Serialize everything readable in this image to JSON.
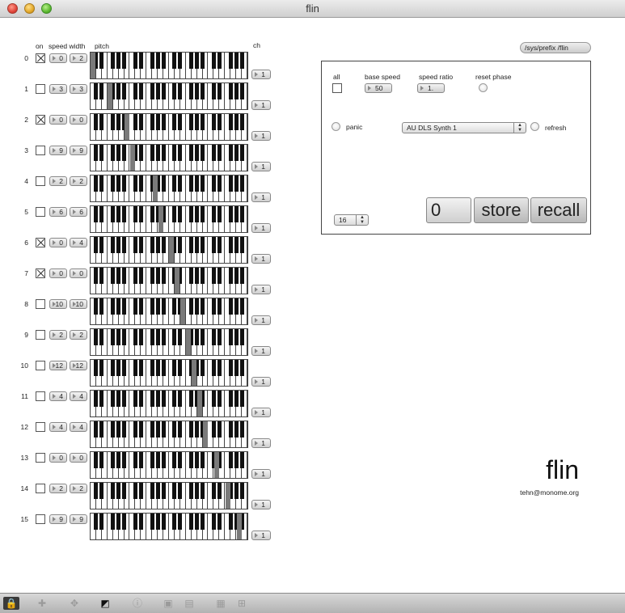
{
  "window": {
    "title": "flin"
  },
  "headers": {
    "on": "on",
    "speed_width": "speed width",
    "pitch": "pitch",
    "ch": "ch"
  },
  "rows": [
    {
      "label": "0",
      "on": true,
      "speed": "0",
      "width": "2",
      "ch": "1",
      "pitch": 0
    },
    {
      "label": "1",
      "on": false,
      "speed": "3",
      "width": "3",
      "ch": "1",
      "pitch": 3
    },
    {
      "label": "2",
      "on": true,
      "speed": "0",
      "width": "0",
      "ch": "1",
      "pitch": 6
    },
    {
      "label": "3",
      "on": false,
      "speed": "9",
      "width": "9",
      "ch": "1",
      "pitch": 7
    },
    {
      "label": "4",
      "on": false,
      "speed": "2",
      "width": "2",
      "ch": "1",
      "pitch": 11
    },
    {
      "label": "5",
      "on": false,
      "speed": "6",
      "width": "6",
      "ch": "1",
      "pitch": 12
    },
    {
      "label": "6",
      "on": true,
      "speed": "0",
      "width": "4",
      "ch": "1",
      "pitch": 14
    },
    {
      "label": "7",
      "on": true,
      "speed": "0",
      "width": "0",
      "ch": "1",
      "pitch": 15
    },
    {
      "label": "8",
      "on": false,
      "speed": "10",
      "width": "10",
      "ch": "1",
      "pitch": 16
    },
    {
      "label": "9",
      "on": false,
      "speed": "2",
      "width": "2",
      "ch": "1",
      "pitch": 17
    },
    {
      "label": "10",
      "on": false,
      "speed": "12",
      "width": "12",
      "ch": "1",
      "pitch": 18
    },
    {
      "label": "11",
      "on": false,
      "speed": "4",
      "width": "4",
      "ch": "1",
      "pitch": 19
    },
    {
      "label": "12",
      "on": false,
      "speed": "4",
      "width": "4",
      "ch": "1",
      "pitch": 20
    },
    {
      "label": "13",
      "on": false,
      "speed": "0",
      "width": "0",
      "ch": "1",
      "pitch": 22
    },
    {
      "label": "14",
      "on": false,
      "speed": "2",
      "width": "2",
      "ch": "1",
      "pitch": 24
    },
    {
      "label": "15",
      "on": false,
      "speed": "9",
      "width": "9",
      "ch": "1",
      "pitch": 26
    }
  ],
  "panel": {
    "prefix": "/sys/prefix /flin",
    "all_label": "all",
    "base_speed_label": "base speed",
    "base_speed_value": "50",
    "speed_ratio_label": "speed ratio",
    "speed_ratio_value": "1.",
    "reset_phase_label": "reset phase",
    "panic_label": "panic",
    "synth_menu": "AU DLS Synth 1",
    "refresh_label": "refresh",
    "size_menu": "16",
    "preset_number": "0",
    "store_label": "store",
    "recall_label": "recall"
  },
  "brand": {
    "name": "flin",
    "email": "tehn@monome.org"
  },
  "toolbar": {
    "icons": [
      "lock-icon",
      "add-object-icon",
      "move-icon",
      "presentation-icon",
      "info-icon",
      "align-icon",
      "grid-snap-icon",
      "grid-icon",
      "patch-cord-icon"
    ]
  }
}
